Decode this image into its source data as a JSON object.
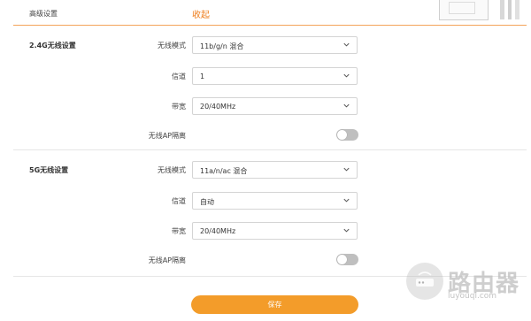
{
  "header": {
    "advanced_settings": "高级设置",
    "collapse": "收起"
  },
  "band_24": {
    "title": "2.4G无线设置",
    "mode_label": "无线模式",
    "mode_value": "11b/g/n 混合",
    "channel_label": "信道",
    "channel_value": "1",
    "bandwidth_label": "带宽",
    "bandwidth_value": "20/40MHz",
    "ap_isolation_label": "无线AP隔离",
    "ap_isolation_on": false
  },
  "band_5": {
    "title": "5G无线设置",
    "mode_label": "无线模式",
    "mode_value": "11a/n/ac 混合",
    "channel_label": "信道",
    "channel_value": "自动",
    "bandwidth_label": "带宽",
    "bandwidth_value": "20/40MHz",
    "ap_isolation_label": "无线AP隔离",
    "ap_isolation_on": false
  },
  "footer": {
    "save_label": "保存"
  },
  "watermark": {
    "text": "路由器",
    "sub": "luyouqi.com"
  },
  "colors": {
    "accent": "#ee7d1c",
    "button": "#f39c2a",
    "toggle_off": "#bfbfbf"
  }
}
